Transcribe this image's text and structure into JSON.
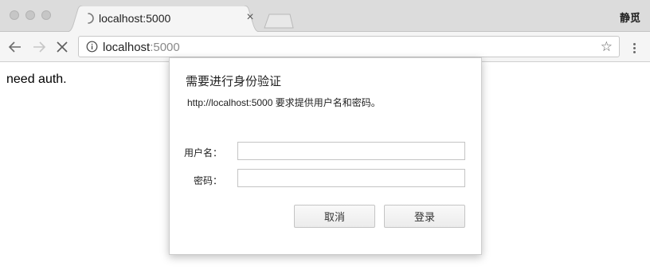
{
  "window": {
    "profile_name": "静觅"
  },
  "tab": {
    "title": "localhost:5000",
    "close_glyph": "×",
    "loading": true
  },
  "toolbar": {
    "url_host": "localhost",
    "url_port": ":5000",
    "star_glyph": "☆"
  },
  "page": {
    "body_text": "need auth."
  },
  "auth_dialog": {
    "title": "需要进行身份验证",
    "message": "http://localhost:5000 要求提供用户名和密码。",
    "username_label": "用户名：",
    "password_label": "密码：",
    "username_value": "",
    "password_value": "",
    "cancel_label": "取消",
    "login_label": "登录"
  },
  "colors": {
    "tabstrip_bg": "#dcdcdc",
    "toolbar_bg": "#f5f5f5",
    "url_port_color": "#8a8a8a"
  }
}
